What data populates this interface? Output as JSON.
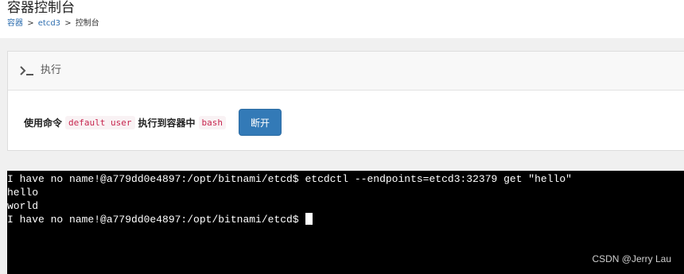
{
  "header": {
    "title": "容器控制台",
    "breadcrumb": {
      "items": [
        "容器",
        "etcd3"
      ],
      "current": "控制台",
      "separator": ">"
    }
  },
  "panel": {
    "icon": "terminal-icon",
    "title": "执行",
    "text_prefix": "使用命令",
    "user_code": "default user",
    "text_middle": "执行到容器中",
    "shell_code": "bash",
    "disconnect_label": "断开"
  },
  "terminal": {
    "lines": [
      "I have no name!@a779dd0e4897:/opt/bitnami/etcd$ etcdctl --endpoints=etcd3:32379 get \"hello\"",
      "hello",
      "world"
    ],
    "prompt": "I have no name!@a779dd0e4897:/opt/bitnami/etcd$"
  },
  "watermark": "CSDN @Jerry Lau",
  "colors": {
    "accent": "#337ab7",
    "code_text": "#c7254e",
    "terminal_bg": "#000000"
  }
}
